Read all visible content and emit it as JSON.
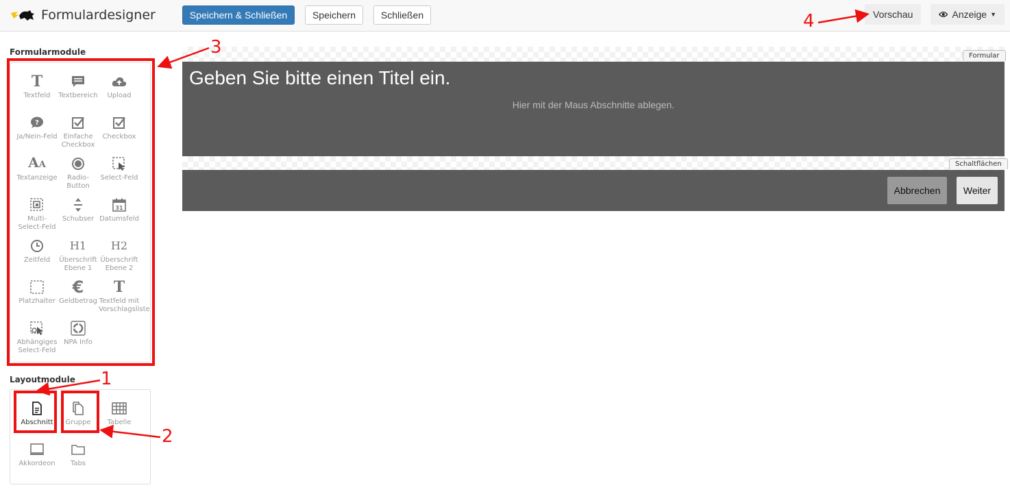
{
  "header": {
    "app_title": "Formulardesigner",
    "save_close_label": "Speichern & Schließen",
    "save_label": "Speichern",
    "close_label": "Schließen",
    "preview_label": "Vorschau",
    "view_label": "Anzeige"
  },
  "sidebar": {
    "form_modules_title": "Formularmodule",
    "form_modules": [
      {
        "label": "Textfeld",
        "icon": "text-icon"
      },
      {
        "label": "Textbereich",
        "icon": "textarea-icon"
      },
      {
        "label": "Upload",
        "icon": "cloud-upload-icon"
      },
      {
        "label": "Ja/Nein-Feld",
        "icon": "question-bubble-icon"
      },
      {
        "label": "Einfache Checkbox",
        "icon": "checkbox-icon"
      },
      {
        "label": "Checkbox",
        "icon": "checkbox-icon"
      },
      {
        "label": "Textanzeige",
        "icon": "text-display-icon"
      },
      {
        "label": "Radio-Button",
        "icon": "radio-icon"
      },
      {
        "label": "Select-Feld",
        "icon": "select-icon"
      },
      {
        "label": "Multi-Select-Feld",
        "icon": "multi-select-icon"
      },
      {
        "label": "Schubser",
        "icon": "slider-icon"
      },
      {
        "label": "Datumsfeld",
        "icon": "calendar-icon"
      },
      {
        "label": "Zeitfeld",
        "icon": "clock-icon"
      },
      {
        "label": "Überschrift Ebene 1",
        "icon": "h1-icon"
      },
      {
        "label": "Überschrift Ebene 2",
        "icon": "h2-icon"
      },
      {
        "label": "Platzhalter",
        "icon": "placeholder-icon"
      },
      {
        "label": "Geldbetrag",
        "icon": "euro-icon"
      },
      {
        "label": "Textfeld mit Vorschlagsliste",
        "icon": "text-suggest-icon"
      },
      {
        "label": "Abhängiges Select-Feld",
        "icon": "dependent-select-icon"
      },
      {
        "label": "NPA Info",
        "icon": "npa-icon"
      }
    ],
    "layout_modules_title": "Layoutmodule",
    "layout_modules": [
      {
        "label": "Abschnitt",
        "icon": "document-icon"
      },
      {
        "label": "Gruppe",
        "icon": "copy-icon"
      },
      {
        "label": "Tabelle",
        "icon": "table-icon"
      },
      {
        "label": "Akkordeon",
        "icon": "accordion-icon"
      },
      {
        "label": "Tabs",
        "icon": "folder-icon"
      }
    ]
  },
  "canvas": {
    "form_tag": "Formular",
    "title_placeholder": "Geben Sie bitte einen Titel ein.",
    "drop_hint": "Hier mit der Maus Abschnitte ablegen.",
    "buttons_tag": "Schaltflächen",
    "cancel_label": "Abbrechen",
    "next_label": "Weiter"
  },
  "annotations": {
    "n1": "1",
    "n2": "2",
    "n3": "3",
    "n4": "4"
  },
  "colors": {
    "primary": "#337ab7",
    "panel": "#5b5b5b",
    "annotation": "#e11111"
  }
}
